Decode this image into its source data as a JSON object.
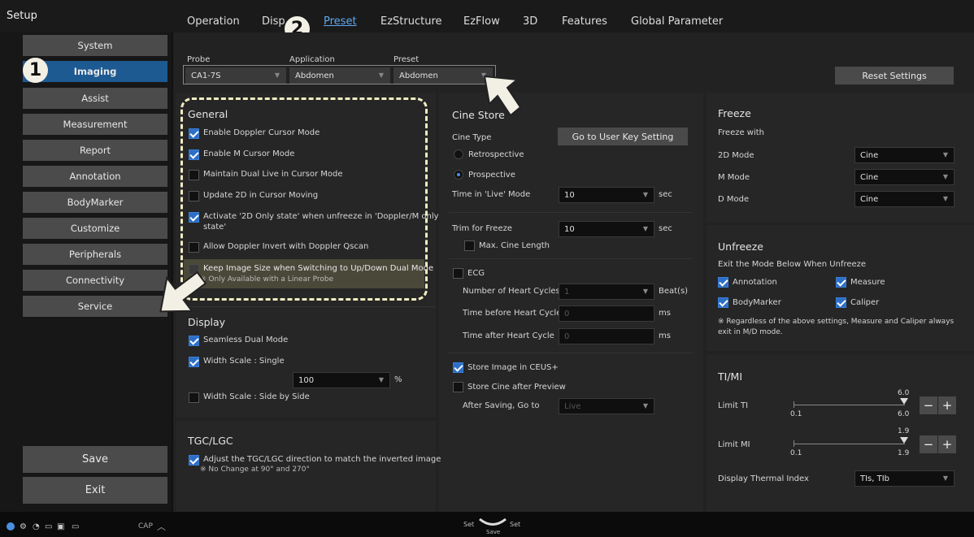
{
  "window": {
    "title": "Setup"
  },
  "tabs": [
    {
      "label": "Operation"
    },
    {
      "label": "Disp"
    },
    {
      "label": "Preset"
    },
    {
      "label": "EzStructure"
    },
    {
      "label": "EzFlow"
    },
    {
      "label": "3D"
    },
    {
      "label": "Features"
    },
    {
      "label": "Global Parameter"
    }
  ],
  "sidebar": {
    "items": [
      {
        "label": "System"
      },
      {
        "label": "Imaging"
      },
      {
        "label": "Assist"
      },
      {
        "label": "Measurement"
      },
      {
        "label": "Report"
      },
      {
        "label": "Annotation"
      },
      {
        "label": "BodyMarker"
      },
      {
        "label": "Customize"
      },
      {
        "label": "Peripherals"
      },
      {
        "label": "Connectivity"
      },
      {
        "label": "Service"
      }
    ],
    "save_label": "Save",
    "exit_label": "Exit"
  },
  "markers": {
    "one": "1",
    "two": "2"
  },
  "selectors": {
    "probe_label": "Probe",
    "probe_value": "CA1-7S",
    "application_label": "Application",
    "application_value": "Abdomen",
    "preset_label": "Preset",
    "preset_value": "Abdomen",
    "reset_label": "Reset Settings"
  },
  "general": {
    "title": "General",
    "items": [
      {
        "label": "Enable Doppler Cursor Mode",
        "checked": true
      },
      {
        "label": "Enable M Cursor Mode",
        "checked": true
      },
      {
        "label": "Maintain Dual Live in Cursor Mode",
        "checked": false
      },
      {
        "label": "Update 2D in Cursor Moving",
        "checked": false
      },
      {
        "label": "Activate '2D Only state' when unfreeze in 'Doppler/M only",
        "label2": "state'",
        "checked": true
      },
      {
        "label": "Allow Doppler Invert with Doppler Qscan",
        "checked": false
      },
      {
        "label": "Keep Image Size when Switching to Up/Down Dual Mode",
        "note": "※ Only Available with a Linear Probe",
        "checked": false
      }
    ]
  },
  "display": {
    "title": "Display",
    "seamless": "Seamless Dual Mode",
    "width_single": "Width Scale : Single",
    "width_value": "100",
    "width_unit": "%",
    "width_side": "Width Scale : Side by Side"
  },
  "tgc": {
    "title": "TGC/LGC",
    "item": "Adjust the TGC/LGC direction to match the inverted image",
    "note": "※ No Change at 90° and 270°"
  },
  "cine": {
    "title": "Cine Store",
    "type_label": "Cine Type",
    "user_key_button": "Go to User Key Setting",
    "retro": "Retrospective",
    "prosp": "Prospective",
    "time_live_label": "Time in 'Live' Mode",
    "time_live_value": "10",
    "sec": "sec",
    "trim_label": "Trim for Freeze",
    "trim_value": "10",
    "max_cine": "Max. Cine Length",
    "ecg": "ECG",
    "heart_cycles_label": "Number of Heart Cycles",
    "heart_cycles_value": "1",
    "heart_cycles_unit": "Beat(s)",
    "before_label": "Time before Heart Cycle",
    "before_value": "0",
    "after_label": "Time after Heart Cycle",
    "after_value": "0",
    "ms": "ms",
    "ceus": "Store Image in CEUS+",
    "after_preview": "Store Cine after Preview",
    "after_saving_label": "After Saving, Go to",
    "after_saving_value": "Live"
  },
  "freeze": {
    "title": "Freeze",
    "with_label": "Freeze with",
    "rows": [
      {
        "label": "2D Mode",
        "value": "Cine"
      },
      {
        "label": "M Mode",
        "value": "Cine"
      },
      {
        "label": "D Mode",
        "value": "Cine"
      }
    ]
  },
  "unfreeze": {
    "title": "Unfreeze",
    "desc": "Exit the Mode Below When Unfreeze",
    "annotation": "Annotation",
    "measure": "Measure",
    "bodymarker": "BodyMarker",
    "caliper": "Caliper",
    "note1": "※ Regardless of the above settings, Measure and Caliper always",
    "note2": "exit in M/D mode."
  },
  "timi": {
    "title": "TI/MI",
    "limit_ti": "Limit TI",
    "ti_min": "0.1",
    "ti_max": "6.0",
    "ti_value": "6.0",
    "limit_mi": "Limit MI",
    "mi_min": "0.1",
    "mi_max": "1.9",
    "mi_value": "1.9",
    "thermal_label": "Display Thermal Index",
    "thermal_value": "TIs, TIb",
    "minus": "−",
    "plus": "+"
  },
  "status": {
    "cap": "CAP",
    "set_left": "Set",
    "set_right": "Set",
    "save": "Save"
  }
}
